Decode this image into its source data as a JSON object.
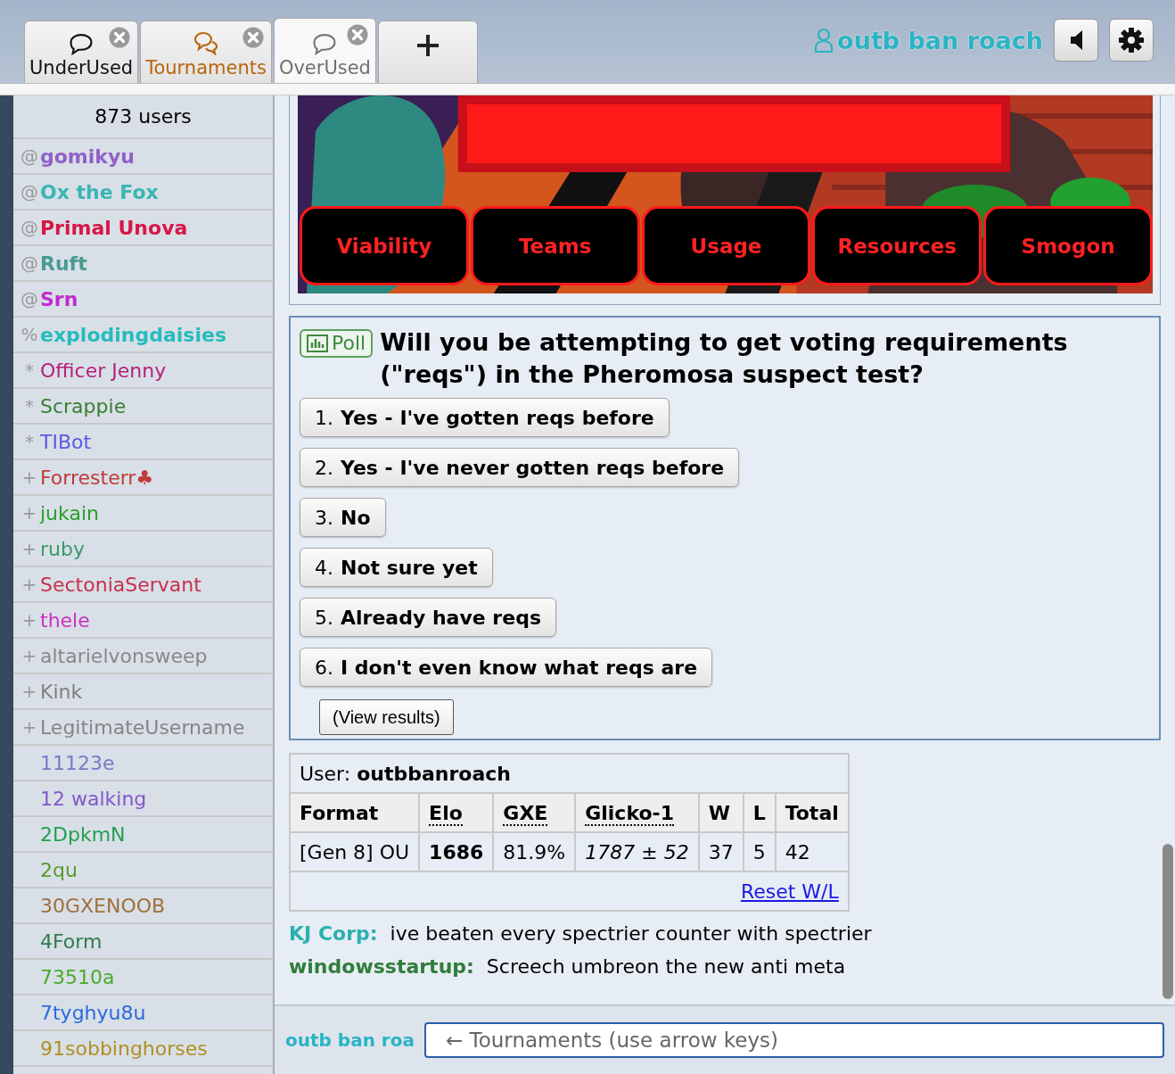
{
  "tabs": [
    {
      "kind": "room",
      "label": "UnderUsed",
      "selected": false,
      "notify": false
    },
    {
      "kind": "room",
      "label": "Tournaments",
      "selected": false,
      "notify": true
    },
    {
      "kind": "room",
      "label": "OverUsed",
      "selected": true,
      "notify": false
    },
    {
      "kind": "new",
      "selected": false
    }
  ],
  "account": {
    "username": "outb ban roach"
  },
  "userlist": {
    "count": "873 users",
    "users": [
      {
        "rank": "@",
        "name": "gomikyu",
        "color": "#9060c8",
        "bold": true
      },
      {
        "rank": "@",
        "name": "Ox the Fox",
        "color": "#3ab5b5",
        "bold": true
      },
      {
        "rank": "@",
        "name": "Primal Unova",
        "color": "#d81646",
        "bold": true
      },
      {
        "rank": "@",
        "name": "Ruft",
        "color": "#4a9a90",
        "bold": true
      },
      {
        "rank": "@",
        "name": "Srn",
        "color": "#c22ad0",
        "bold": true
      },
      {
        "rank": "%",
        "name": "explodingdaisies",
        "color": "#26bcbc",
        "bold": true
      },
      {
        "rank": "*",
        "name": "Officer Jenny",
        "color": "#b5207a",
        "bold": false
      },
      {
        "rank": "*",
        "name": "Scrappie",
        "color": "#3a7d32",
        "bold": false
      },
      {
        "rank": "*",
        "name": "TIBot",
        "color": "#5a5ae0",
        "bold": false
      },
      {
        "rank": "+",
        "name": "Forresterr♣",
        "color": "#c03a3a",
        "bold": false
      },
      {
        "rank": "+",
        "name": "jukain",
        "color": "#2aa02a",
        "bold": false
      },
      {
        "rank": "+",
        "name": "ruby",
        "color": "#3a9a6a",
        "bold": false
      },
      {
        "rank": "+",
        "name": "SectoniaServant",
        "color": "#c8304c",
        "bold": false
      },
      {
        "rank": "+",
        "name": "thele",
        "color": "#cc30c0",
        "bold": false
      },
      {
        "rank": "+",
        "name": "altarielvonsweep",
        "color": "#888888",
        "bold": false
      },
      {
        "rank": "+",
        "name": "Kink",
        "color": "#808080",
        "bold": false
      },
      {
        "rank": "+",
        "name": "LegitimateUsername",
        "color": "#858585",
        "bold": false
      },
      {
        "name": "11123e",
        "color": "#7a78c8",
        "bold": false
      },
      {
        "name": "12 walking",
        "color": "#8458c8",
        "bold": false
      },
      {
        "name": "2DpkmN",
        "color": "#24a050",
        "bold": false
      },
      {
        "name": "2qu",
        "color": "#5a9a2a",
        "bold": false
      },
      {
        "name": "30GXENOOB",
        "color": "#a0703a",
        "bold": false
      },
      {
        "name": "4Form",
        "color": "#2e7a50",
        "bold": false
      },
      {
        "name": "73510a",
        "color": "#4aaa2a",
        "bold": false
      },
      {
        "name": "7tyghyu8u",
        "color": "#2a6ae0",
        "bold": false
      },
      {
        "name": "91sobbinghorses",
        "color": "#b09020",
        "bold": false
      }
    ]
  },
  "banner": {
    "kind": "picture",
    "links": [
      "Viability",
      "Teams",
      "Usage",
      "Resources",
      "Smogon"
    ]
  },
  "poll": {
    "tag": "Poll",
    "question": "Will you be attempting to get voting requirements (\"reqs\") in the Pheromosa suspect test?",
    "options": [
      {
        "number": "1.",
        "label": "Yes - I've gotten reqs before"
      },
      {
        "number": "2.",
        "label": "Yes - I've never gotten reqs before"
      },
      {
        "number": "3.",
        "label": "No"
      },
      {
        "number": "4.",
        "label": "Not sure yet"
      },
      {
        "number": "5.",
        "label": "Already have reqs"
      },
      {
        "number": "6.",
        "label": "I don't even know what reqs are"
      }
    ],
    "results_button": "(View results)"
  },
  "ranking": {
    "user_label": "User:",
    "user": "outbbanroach",
    "columns": [
      {
        "label": "Format",
        "abbr": false
      },
      {
        "label": "Elo",
        "abbr": true
      },
      {
        "label": "GXE",
        "abbr": true
      },
      {
        "label": "Glicko-1",
        "abbr": true
      },
      {
        "label": "W",
        "abbr": false
      },
      {
        "label": "L",
        "abbr": false
      },
      {
        "label": "Total",
        "abbr": false
      }
    ],
    "rows": [
      {
        "format": "[Gen 8] OU",
        "elo": "1686",
        "gxe": "81.9%",
        "glicko": "1787 ± 52",
        "w": "37",
        "l": "5",
        "total": "42"
      }
    ],
    "reset_link": "Reset W/L"
  },
  "chat": [
    {
      "user": "KJ Corp:",
      "color": "#2bb0b0",
      "text": "ive beaten every spectrier counter with spectrier"
    },
    {
      "user": "windowsstartup:",
      "color": "#2f7d3a",
      "text": "Screech umbreon the new anti meta"
    }
  ],
  "composer": {
    "name": "outb ban roa",
    "placeholder": "← Tournaments (use arrow keys)"
  }
}
